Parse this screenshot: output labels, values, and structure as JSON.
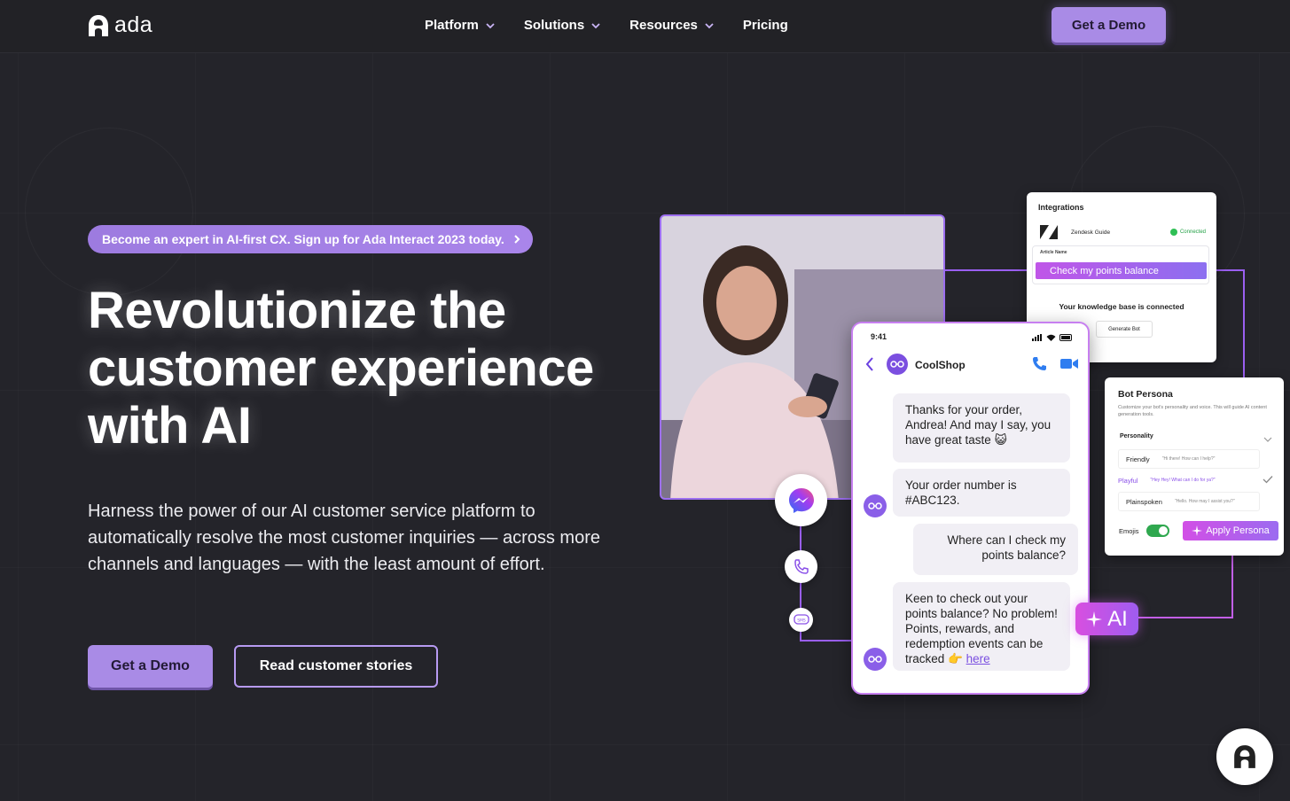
{
  "nav": {
    "logo_text": "ada",
    "links": [
      {
        "label": "Platform",
        "has_dropdown": true
      },
      {
        "label": "Solutions",
        "has_dropdown": true
      },
      {
        "label": "Resources",
        "has_dropdown": true
      },
      {
        "label": "Pricing",
        "has_dropdown": false
      }
    ],
    "cta_label": "Get a Demo"
  },
  "hero": {
    "announcement": "Become an expert in AI-first CX. Sign up for Ada Interact 2023 today.",
    "headline": "Revolutionize the customer experience with AI",
    "subcopy": "Harness the power of our AI customer service platform to automatically resolve the most customer inquiries — across more channels and languages — with the least amount of effort.",
    "primary_cta": "Get a Demo",
    "secondary_cta": "Read customer stories"
  },
  "integrations_card": {
    "title": "Integrations",
    "integration_name": "Zendesk Guide",
    "status": "Connected",
    "article_label": "Article Name",
    "article_value": "Check my points balance",
    "kb_message": "Your knowledge base is connected",
    "button_label": "Generate Bot"
  },
  "persona_card": {
    "title": "Bot Persona",
    "description": "Customize your bot's personality and voice. This will guide AI content generation tools.",
    "personality_label": "Personality",
    "options": [
      {
        "name": "Friendly",
        "sample": "\"Hi there! How can I help?\""
      },
      {
        "name": "Playful",
        "sample": "\"Hey Hey! What can I do for ya?\"",
        "selected": true
      },
      {
        "name": "Plainspoken",
        "sample": "\"Hello. How may I assist you?\""
      }
    ],
    "emojis_label": "Emojis",
    "apply_label": "Apply Persona"
  },
  "phone": {
    "time": "9:41",
    "shop_name": "CoolShop",
    "messages": [
      {
        "from": "bot",
        "text": "Thanks for your order, Andrea! And may I say, you have great taste 😺"
      },
      {
        "from": "bot",
        "text": "Your order number is #ABC123."
      },
      {
        "from": "user",
        "text": "Where can I check my points balance?"
      },
      {
        "from": "bot",
        "text": "Keen to check out your points balance? No problem! Points, rewards, and redemption events can be tracked 👉",
        "link": "here"
      }
    ]
  },
  "ai_badge": "AI",
  "channel_sms_label": "SMS",
  "colors": {
    "background": "#24242a",
    "accent": "#a98be6",
    "magenta": "#d24fe6"
  }
}
